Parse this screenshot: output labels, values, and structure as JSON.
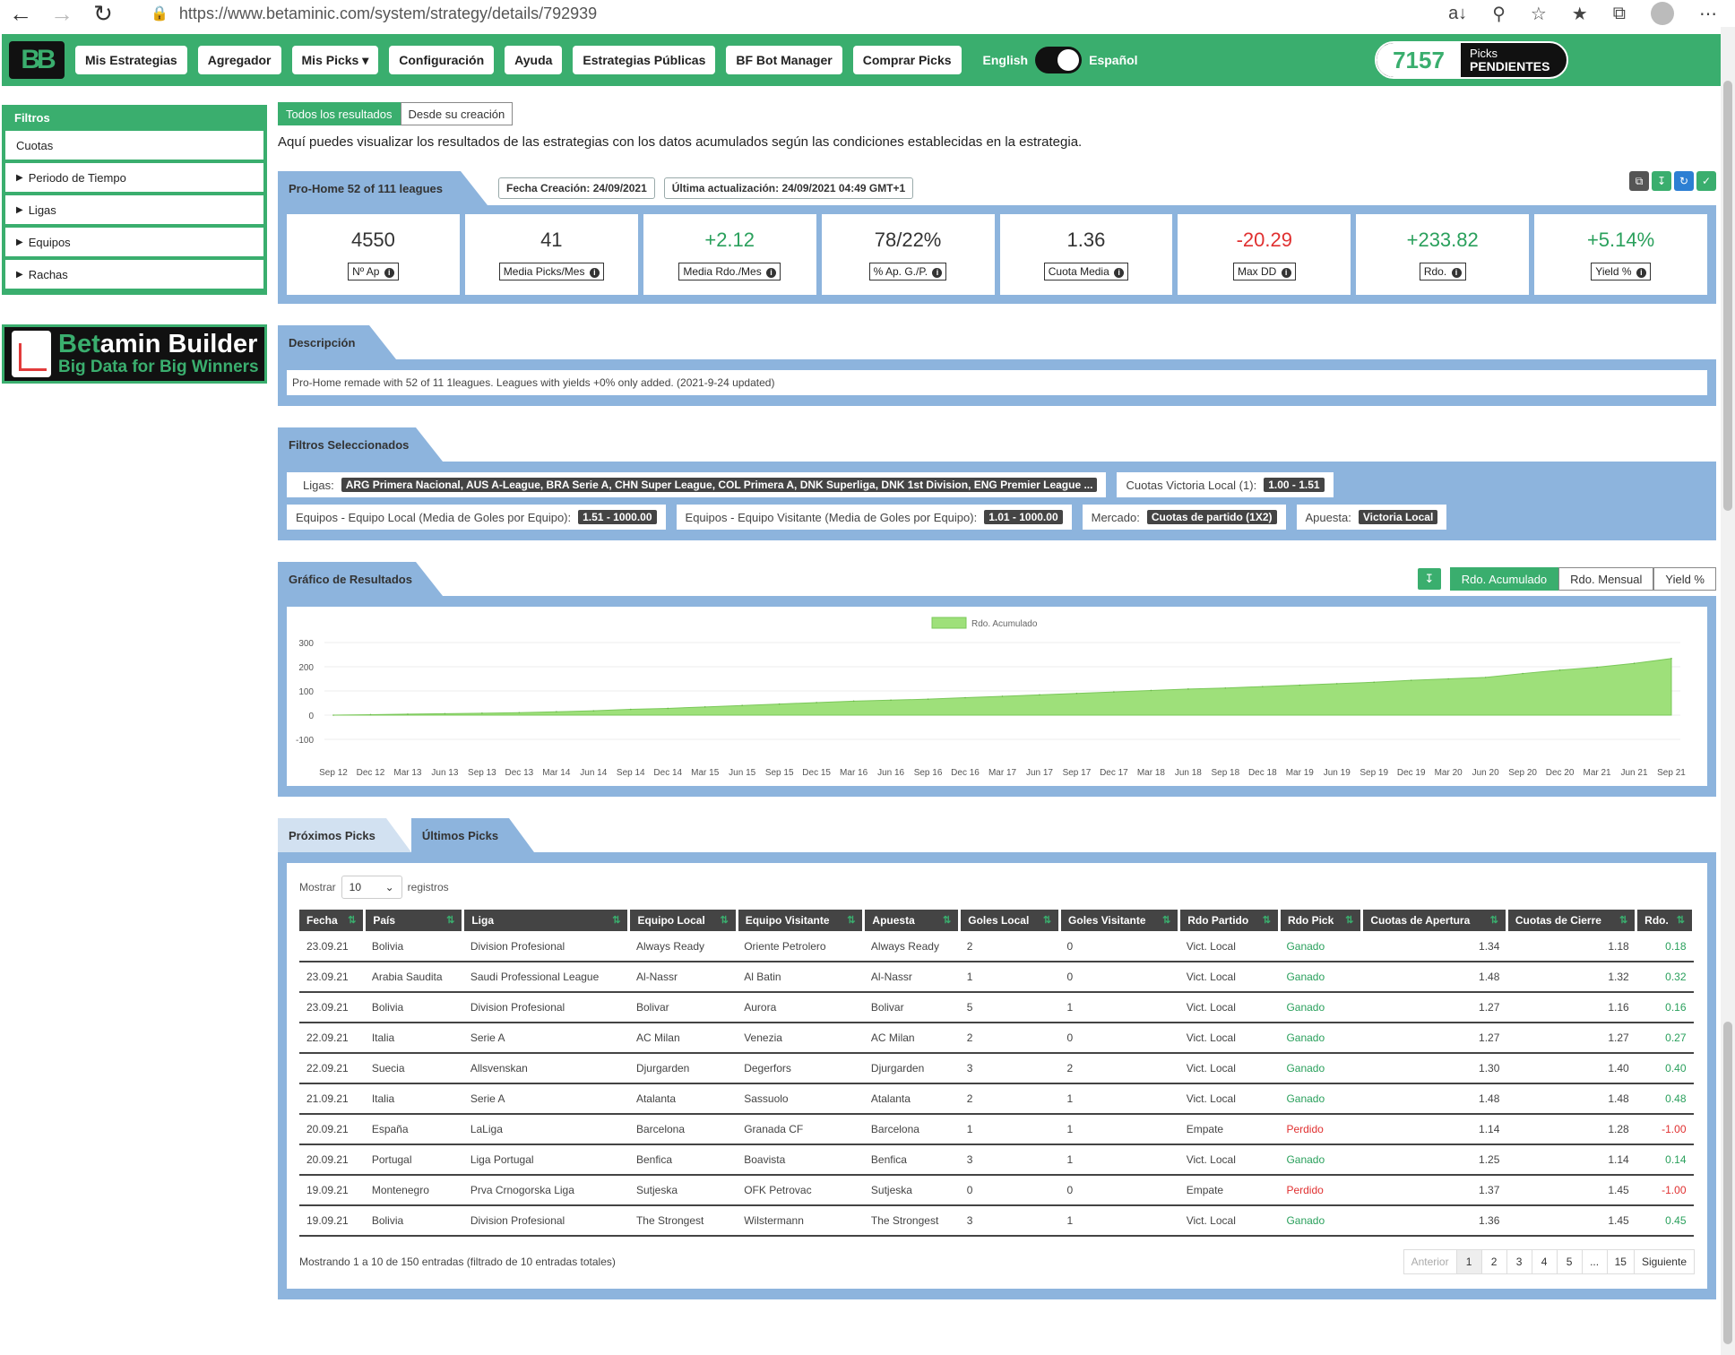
{
  "browser": {
    "url": "https://www.betaminic.com/system/strategy/details/792939"
  },
  "navbar": {
    "logo": "BB",
    "items": [
      "Mis Estrategias",
      "Agregador",
      "Mis Picks ▾",
      "Configuración",
      "Ayuda",
      "Estrategias Públicas",
      "BF Bot Manager",
      "Comprar Picks"
    ],
    "lang_en": "English",
    "lang_es": "Español",
    "pending_count": "7157",
    "pending_label_top": "Picks",
    "pending_label_bottom": "PENDIENTES"
  },
  "sidebar": {
    "title": "Filtros",
    "items": [
      "Cuotas",
      "Periodo de Tiempo",
      "Ligas",
      "Equipos",
      "Rachas"
    ],
    "builder_title_a": "Bet",
    "builder_title_b": "amin Builder",
    "builder_sub": "Big Data for Big Winners"
  },
  "main": {
    "tab_all": "Todos los resultados",
    "tab_since": "Desde su creación",
    "intro": "Aquí puedes visualizar los resultados de las estrategias con los datos acumulados según las condiciones establecidas en la estrategia.",
    "strategy_name": "Pro-Home 52 of 111 leagues",
    "created": "Fecha Creación: 24/09/2021",
    "updated": "Última actualización: 24/09/2021 04:49 GMT+1",
    "stats": [
      {
        "value": "4550",
        "label": "Nº Ap",
        "tone": "neutral"
      },
      {
        "value": "41",
        "label": "Media Picks/Mes",
        "tone": "neutral"
      },
      {
        "value": "+2.12",
        "label": "Media Rdo./Mes",
        "tone": "pos"
      },
      {
        "value": "78/22%",
        "label": "% Ap. G./P.",
        "tone": "neutral"
      },
      {
        "value": "1.36",
        "label": "Cuota Media",
        "tone": "neutral"
      },
      {
        "value": "-20.29",
        "label": "Max DD",
        "tone": "neg"
      },
      {
        "value": "+233.82",
        "label": "Rdo.",
        "tone": "pos"
      },
      {
        "value": "+5.14%",
        "label": "Yield %",
        "tone": "pos"
      }
    ],
    "desc_title": "Descripción",
    "description": "Pro-Home remade with 52 of 11 1leagues. Leagues with yields +0% only added. (2021-9-24 updated)",
    "filters_title": "Filtros Seleccionados",
    "filters": [
      {
        "label": "Ligas:",
        "value": "ARG Primera Nacional, AUS A-League, BRA Serie A, CHN Super League, COL Primera A, DNK Superliga, DNK 1st Division, ENG Premier League ..."
      },
      {
        "label": "Cuotas Victoria Local (1):",
        "value": "1.00 - 1.51"
      },
      {
        "label": "Equipos - Equipo Local (Media de Goles por Equipo):",
        "value": "1.51 - 1000.00"
      },
      {
        "label": "Equipos - Equipo Visitante (Media de Goles por Equipo):",
        "value": "1.01 - 1000.00"
      },
      {
        "label": "Mercado:",
        "value": "Cuotas de partido (1X2)"
      },
      {
        "label": "Apuesta:",
        "value": "Victoria Local"
      }
    ],
    "chart_title": "Gráfico de Resultados",
    "chart_buttons": [
      "Rdo. Acumulado",
      "Rdo. Mensual",
      "Yield %"
    ],
    "tab_next": "Próximos Picks",
    "tab_last": "Últimos Picks"
  },
  "chart_data": {
    "type": "area",
    "legend": "Rdo. Acumulado",
    "legend_position": "top-center",
    "color": "#9ee07a",
    "ylim": [
      -100,
      300
    ],
    "yticks": [
      300,
      200,
      100,
      0,
      -100
    ],
    "xticks": [
      "Sep 12",
      "Dec 12",
      "Mar 13",
      "Jun 13",
      "Sep 13",
      "Dec 13",
      "Mar 14",
      "Jun 14",
      "Sep 14",
      "Dec 14",
      "Mar 15",
      "Jun 15",
      "Sep 15",
      "Dec 15",
      "Mar 16",
      "Jun 16",
      "Sep 16",
      "Dec 16",
      "Mar 17",
      "Jun 17",
      "Sep 17",
      "Dec 17",
      "Mar 18",
      "Jun 18",
      "Sep 18",
      "Dec 18",
      "Mar 19",
      "Jun 19",
      "Sep 19",
      "Dec 19",
      "Mar 20",
      "Jun 20",
      "Sep 20",
      "Dec 20",
      "Mar 21",
      "Jun 21",
      "Sep 21"
    ],
    "x": [
      "Sep 12",
      "Dec 12",
      "Mar 13",
      "Jun 13",
      "Sep 13",
      "Dec 13",
      "Mar 14",
      "Jun 14",
      "Sep 14",
      "Dec 14",
      "Mar 15",
      "Jun 15",
      "Sep 15",
      "Dec 15",
      "Mar 16",
      "Jun 16",
      "Sep 16",
      "Dec 16",
      "Mar 17",
      "Jun 17",
      "Sep 17",
      "Dec 17",
      "Mar 18",
      "Jun 18",
      "Sep 18",
      "Dec 18",
      "Mar 19",
      "Jun 19",
      "Sep 19",
      "Dec 19",
      "Mar 20",
      "Jun 20",
      "Sep 20",
      "Dec 20",
      "Mar 21",
      "Jun 21",
      "Sep 21"
    ],
    "values": [
      0,
      2,
      4,
      6,
      8,
      10,
      14,
      18,
      24,
      28,
      34,
      40,
      46,
      52,
      58,
      62,
      66,
      72,
      78,
      84,
      90,
      96,
      102,
      108,
      112,
      118,
      124,
      130,
      136,
      144,
      150,
      156,
      172,
      186,
      198,
      214,
      234
    ]
  },
  "table": {
    "show_label": "Mostrar",
    "show_value": "10",
    "records_label": "registros",
    "headers": [
      "Fecha",
      "País",
      "Liga",
      "Equipo Local",
      "Equipo Visitante",
      "Apuesta",
      "Goles Local",
      "Goles Visitante",
      "Rdo Partido",
      "Rdo Pick",
      "Cuotas de Apertura",
      "Cuotas de Cierre",
      "Rdo."
    ],
    "rows": [
      [
        "23.09.21",
        "Bolivia",
        "Division Profesional",
        "Always Ready",
        "Oriente Petrolero",
        "Always Ready",
        "2",
        "0",
        "Vict. Local",
        "Ganado",
        "1.34",
        "1.18",
        "0.18"
      ],
      [
        "23.09.21",
        "Arabia Saudita",
        "Saudi Professional League",
        "Al-Nassr",
        "Al Batin",
        "Al-Nassr",
        "1",
        "0",
        "Vict. Local",
        "Ganado",
        "1.48",
        "1.32",
        "0.32"
      ],
      [
        "23.09.21",
        "Bolivia",
        "Division Profesional",
        "Bolivar",
        "Aurora",
        "Bolivar",
        "5",
        "1",
        "Vict. Local",
        "Ganado",
        "1.27",
        "1.16",
        "0.16"
      ],
      [
        "22.09.21",
        "Italia",
        "Serie A",
        "AC Milan",
        "Venezia",
        "AC Milan",
        "2",
        "0",
        "Vict. Local",
        "Ganado",
        "1.27",
        "1.27",
        "0.27"
      ],
      [
        "22.09.21",
        "Suecia",
        "Allsvenskan",
        "Djurgarden",
        "Degerfors",
        "Djurgarden",
        "3",
        "2",
        "Vict. Local",
        "Ganado",
        "1.30",
        "1.40",
        "0.40"
      ],
      [
        "21.09.21",
        "Italia",
        "Serie A",
        "Atalanta",
        "Sassuolo",
        "Atalanta",
        "2",
        "1",
        "Vict. Local",
        "Ganado",
        "1.48",
        "1.48",
        "0.48"
      ],
      [
        "20.09.21",
        "España",
        "LaLiga",
        "Barcelona",
        "Granada CF",
        "Barcelona",
        "1",
        "1",
        "Empate",
        "Perdido",
        "1.14",
        "1.28",
        "-1.00"
      ],
      [
        "20.09.21",
        "Portugal",
        "Liga Portugal",
        "Benfica",
        "Boavista",
        "Benfica",
        "3",
        "1",
        "Vict. Local",
        "Ganado",
        "1.25",
        "1.14",
        "0.14"
      ],
      [
        "19.09.21",
        "Montenegro",
        "Prva Crnogorska Liga",
        "Sutjeska",
        "OFK Petrovac",
        "Sutjeska",
        "0",
        "0",
        "Empate",
        "Perdido",
        "1.37",
        "1.45",
        "-1.00"
      ],
      [
        "19.09.21",
        "Bolivia",
        "Division Profesional",
        "The Strongest",
        "Wilstermann",
        "The Strongest",
        "3",
        "1",
        "Vict. Local",
        "Ganado",
        "1.36",
        "1.45",
        "0.45"
      ]
    ],
    "info": "Mostrando 1 a 10 de 150 entradas (filtrado de 10 entradas totales)",
    "pager": [
      "Anterior",
      "1",
      "2",
      "3",
      "4",
      "5",
      "...",
      "15",
      "Siguiente"
    ]
  }
}
